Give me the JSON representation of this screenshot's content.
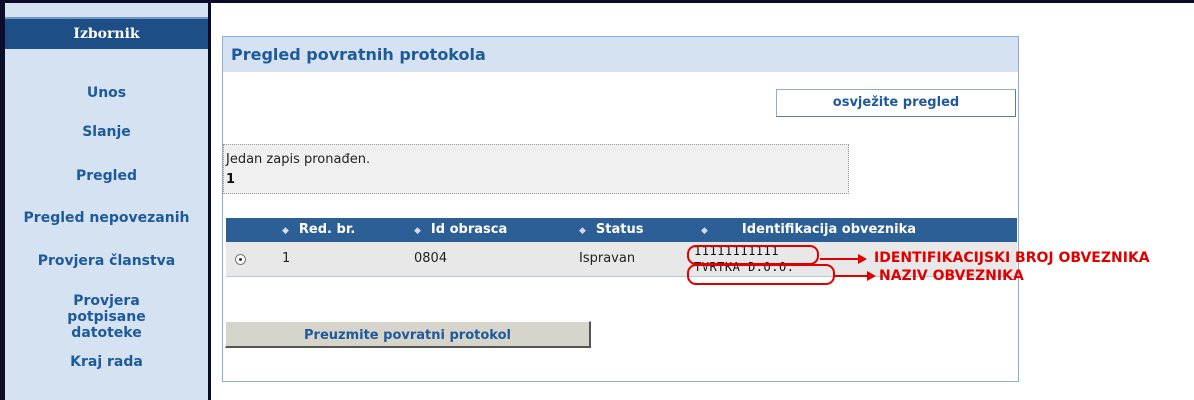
{
  "sidebar": {
    "title": "Izbornik",
    "items": [
      {
        "label": "Unos"
      },
      {
        "label": "Slanje"
      },
      {
        "label": "Pregled"
      },
      {
        "label": "Pregled nepovezanih"
      },
      {
        "label": "Provjera članstva"
      },
      {
        "label": "Provjera potpisane datoteke"
      },
      {
        "label": "Kraj rada"
      }
    ]
  },
  "main": {
    "title": "Pregled povratnih protokola",
    "refresh_label": "osvježite pregled",
    "result_text": "Jedan zapis pronađen.",
    "result_count": "1",
    "table": {
      "columns": [
        "Red. br.",
        "Id obrasca",
        "Status",
        "Identifikacija obveznika"
      ],
      "rows": [
        {
          "red_br": "1",
          "id_obrasca": "0804",
          "status": "Ispravan",
          "ident_broj": "11111111111",
          "naziv": "TVRTKA D.O.O."
        }
      ]
    },
    "download_label": "Preuzmite povratni protokol"
  },
  "annotations": {
    "ident_broj": "IDENTIFIKACIJSKI BROJ OBVEZNIKA",
    "naziv": "NAZIV OBVEZNIKA",
    "color": "#e00000"
  },
  "colors": {
    "sidebar_bg": "#d5e2f1",
    "header_bg": "#1d4e86",
    "table_header_bg": "#2c5f95",
    "link_text": "#1e5a9a"
  }
}
